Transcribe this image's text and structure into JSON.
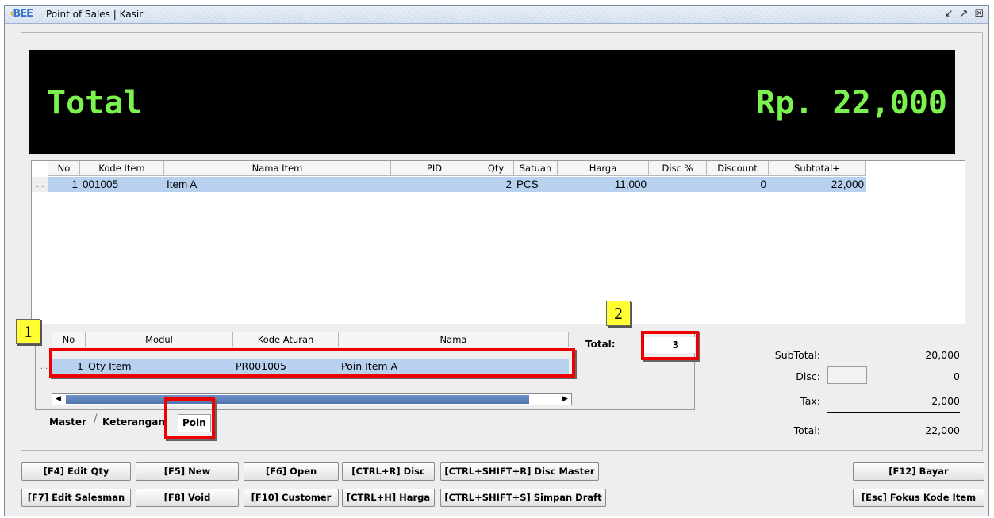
{
  "window": {
    "logo": "BEE",
    "title": "Point of Sales | Kasir"
  },
  "total_display": {
    "label": "Total",
    "amount": "Rp. 22,000"
  },
  "items_grid": {
    "columns": [
      "No",
      "Kode Item",
      "Nama Item",
      "PID",
      "Qty",
      "Satuan",
      "Harga",
      "Disc %",
      "Discount",
      "Subtotal+"
    ],
    "rows": [
      {
        "no": "1",
        "kode": "001005",
        "nama": "Item A",
        "pid": "",
        "qty": "2",
        "satuan": "PCS",
        "harga": "11,000",
        "disc_pct": "",
        "discount": "0",
        "subtotal": "22,000"
      }
    ]
  },
  "poin_grid": {
    "columns": [
      "No",
      "Modul",
      "Kode Aturan",
      "Nama"
    ],
    "rows": [
      {
        "no": "1",
        "modul": "Qty Item",
        "kode_aturan": "PR001005",
        "nama": "Poin Item A"
      }
    ],
    "total_label": "Total:",
    "total_value": "3"
  },
  "tabs": [
    "Master",
    "Keterangan",
    "Poin"
  ],
  "markers": [
    "1",
    "2"
  ],
  "summary": {
    "subtotal_label": "SubTotal:",
    "subtotal_value": "20,000",
    "disc_label": "Disc:",
    "disc_value": "0",
    "tax_label": "Tax:",
    "tax_value": "2,000",
    "total_label": "Total:",
    "total_value": "22,000"
  },
  "buttons": {
    "edit_qty": "[F4] Edit Qty",
    "new": "[F5] New",
    "open": "[F6] Open",
    "disc": "[CTRL+R] Disc",
    "disc_master": "[CTRL+SHIFT+R] Disc Master",
    "bayar": "[F12] Bayar",
    "edit_salesman": "[F7] Edit Salesman",
    "void": "[F8] Void",
    "customer": "[F10] Customer",
    "harga": "[CTRL+H] Harga",
    "simpan_draft": "[CTRL+SHIFT+S] Simpan Draft",
    "fokus_kode": "[Esc] Fokus Kode Item"
  },
  "colors": {
    "total_text": "#7cf24e",
    "selection": "#b7d1ef",
    "highlight_box": "#ee0000",
    "marker_bg": "#ffff33"
  }
}
